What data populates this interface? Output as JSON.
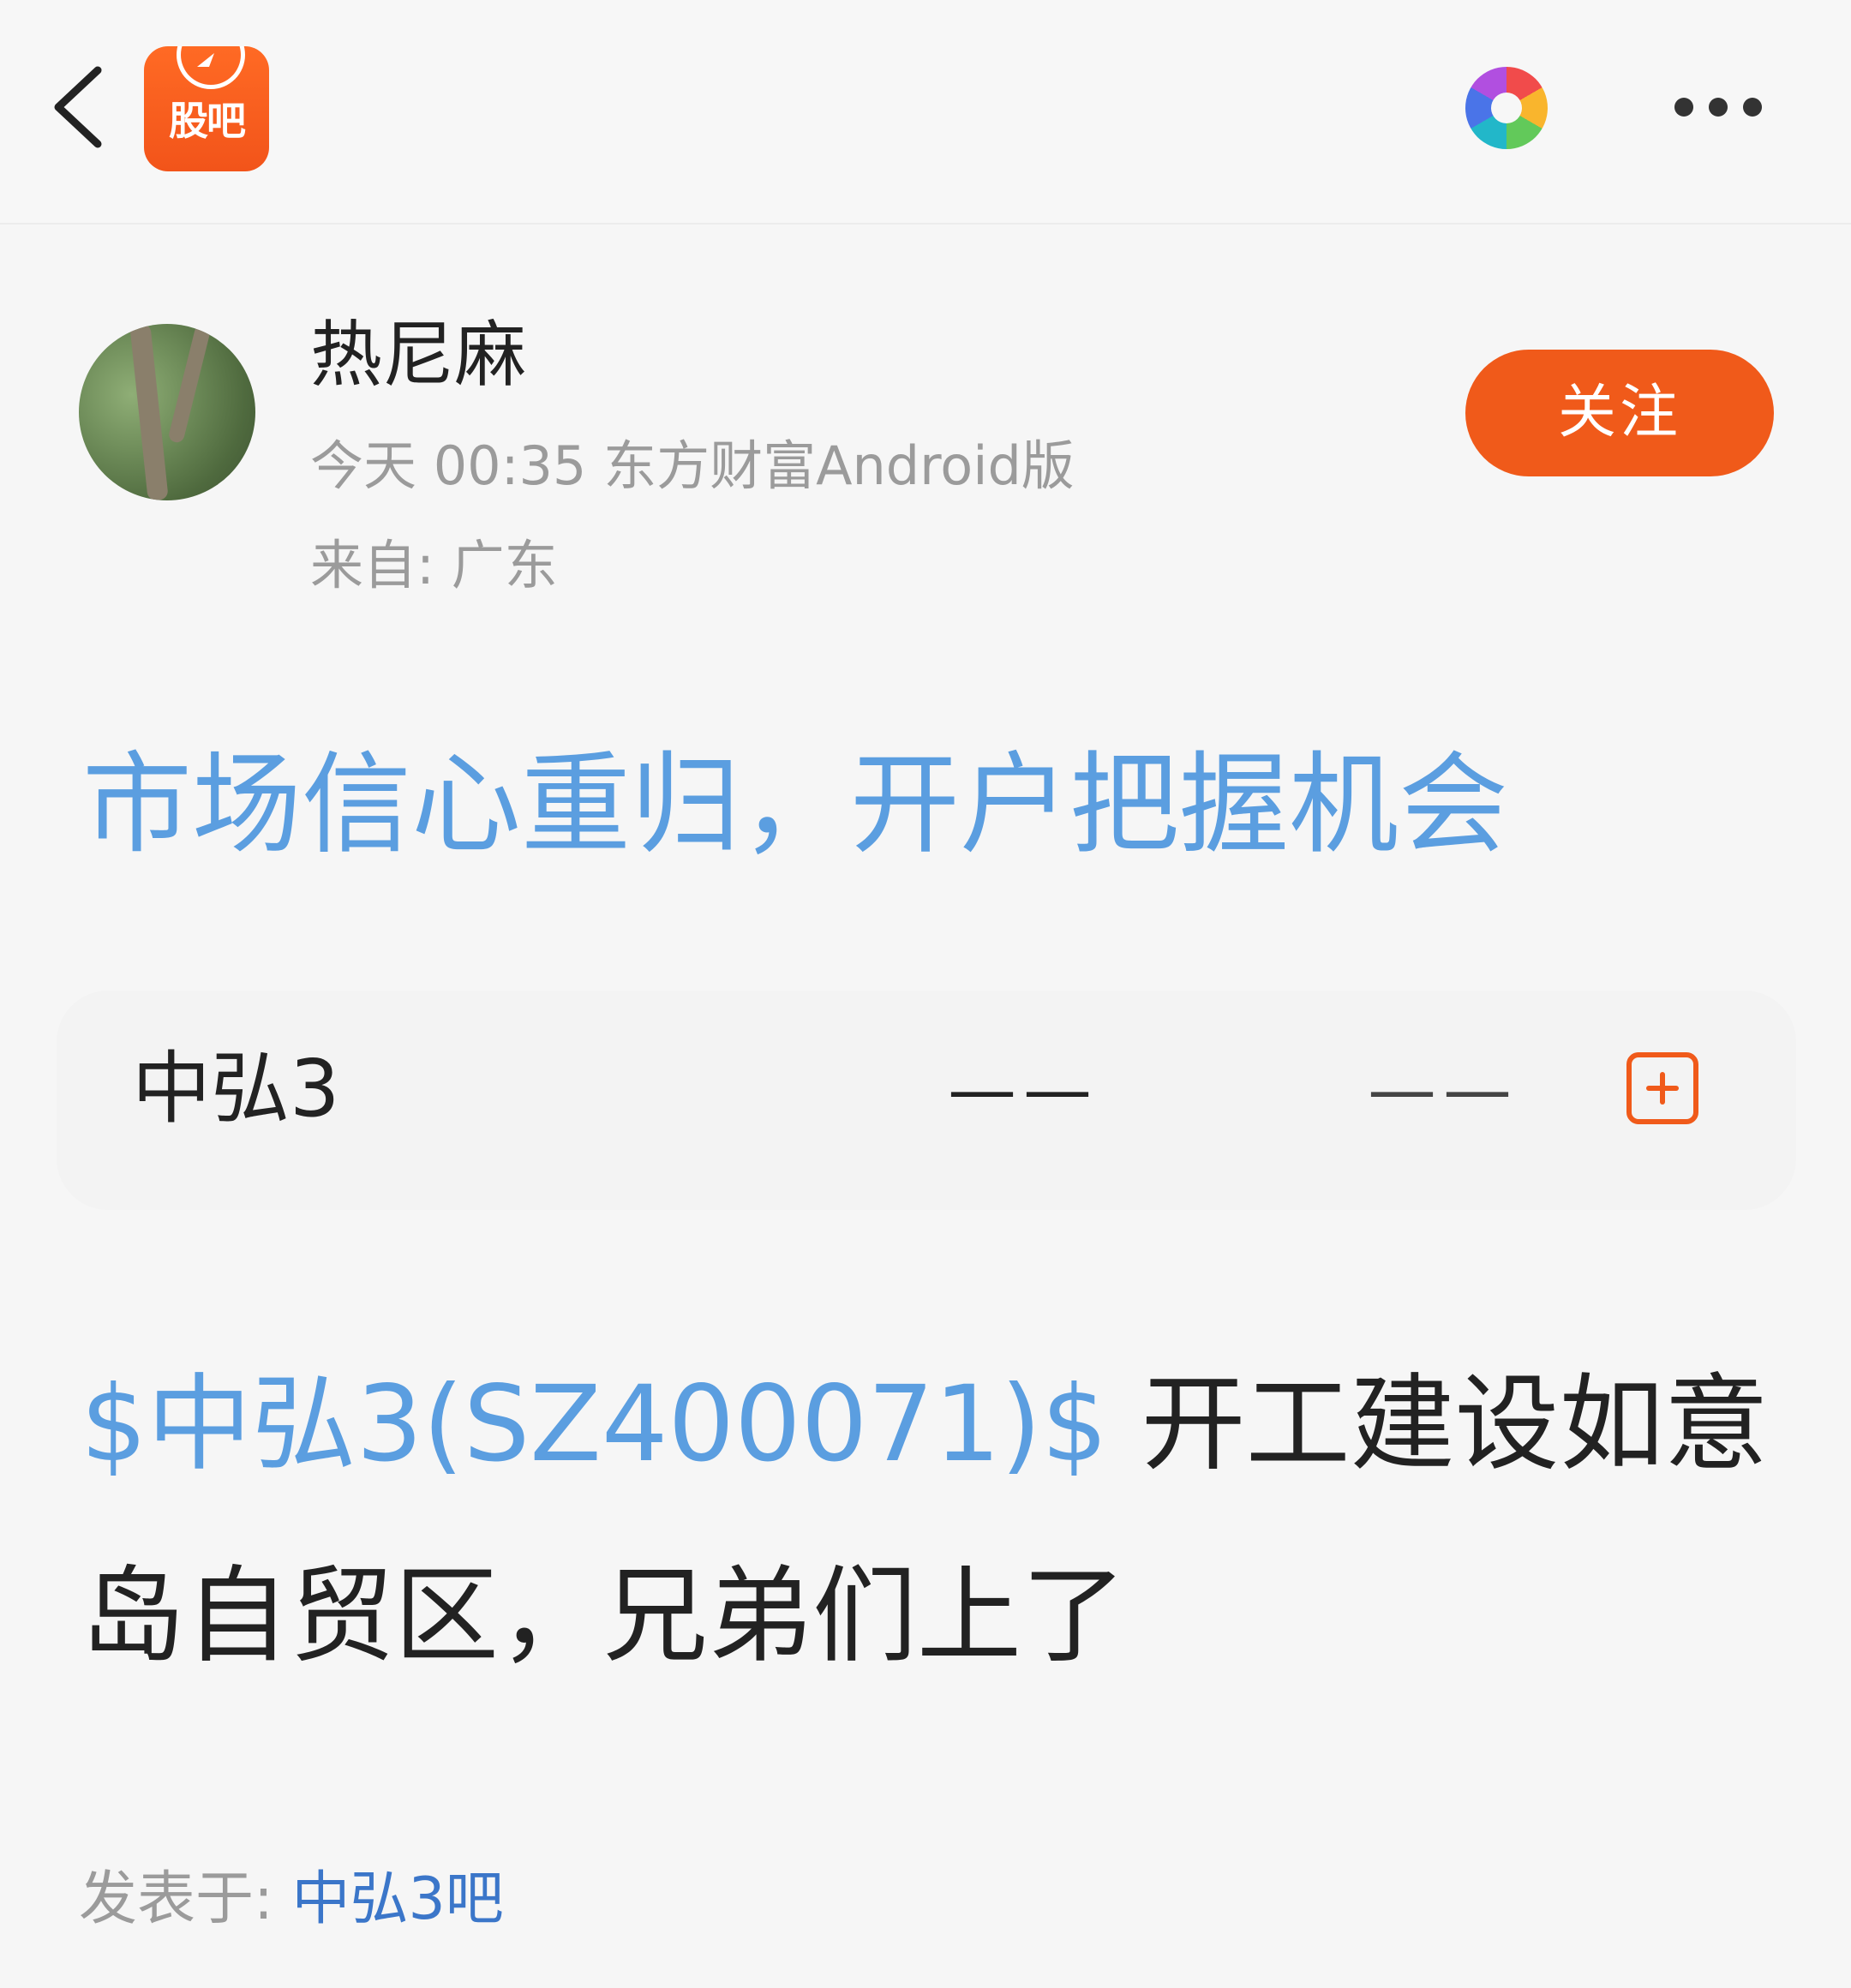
{
  "header": {
    "app_logo_text": "股吧",
    "back_icon": "chevron-left-icon",
    "color_wheel_icon": "color-wheel-icon",
    "more_icon": "more-dots-icon"
  },
  "author": {
    "name": "热尼麻",
    "meta": "今天 00:35 东方财富Android版",
    "location": "来自: 广东",
    "follow_label": "关注"
  },
  "post": {
    "title": "市场信心重归，开户把握机会",
    "body_link": "$中弘3(SZ400071)$",
    "body_text": " 开工建设如意岛自贸区，兄弟们上了"
  },
  "stock_card": {
    "name": "中弘3",
    "price": "——",
    "change": "——",
    "add_icon": "plus-square-icon"
  },
  "footer": {
    "posted_in_label": "发表于: ",
    "bar_name": "中弘3吧"
  },
  "colors": {
    "accent_orange": "#f05a1a",
    "link_blue": "#5b9ee0",
    "bar_link_blue": "#3b76c9",
    "meta_gray": "#9b9b9b"
  }
}
